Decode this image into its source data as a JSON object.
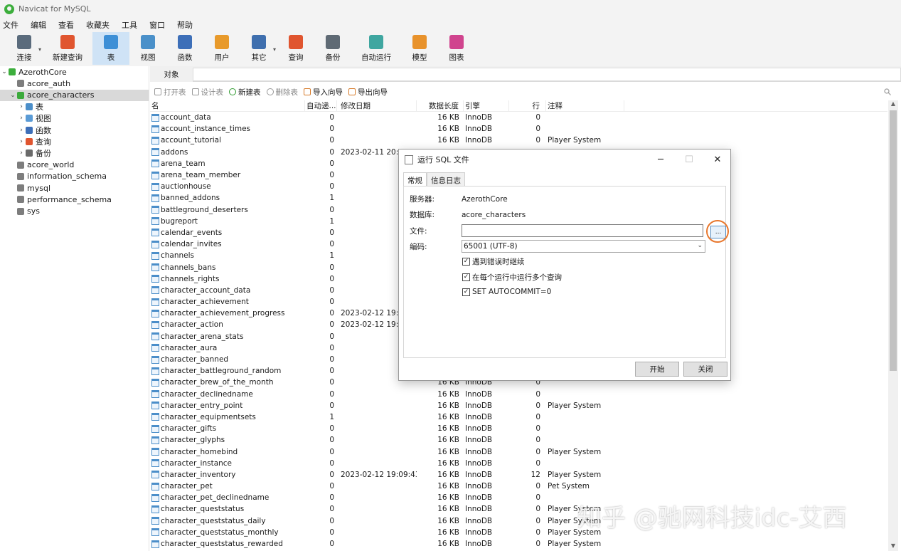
{
  "window": {
    "title": "Navicat for MySQL"
  },
  "menu": [
    "文件",
    "编辑",
    "查看",
    "收藏夹",
    "工具",
    "窗口",
    "帮助"
  ],
  "toolbar": [
    {
      "label": "连接",
      "icon": "connection-icon",
      "color": "#5a6b7c",
      "caret": true
    },
    {
      "label": "新建查询",
      "icon": "new-query-icon",
      "color": "#e0552f"
    },
    {
      "label": "表",
      "icon": "table-icon",
      "color": "#3d8fd6",
      "active": true
    },
    {
      "label": "视图",
      "icon": "view-icon",
      "color": "#4a90c9"
    },
    {
      "label": "函数",
      "icon": "function-icon",
      "color": "#3d6fb8"
    },
    {
      "label": "用户",
      "icon": "user-icon",
      "color": "#e89a2b"
    },
    {
      "label": "其它",
      "icon": "tools-icon",
      "color": "#3f6fae",
      "caret": true
    },
    {
      "label": "查询",
      "icon": "query-icon",
      "color": "#e0552f"
    },
    {
      "label": "备份",
      "icon": "backup-icon",
      "color": "#5f6a74"
    },
    {
      "label": "自动运行",
      "icon": "robot-icon",
      "color": "#3fa6a0"
    },
    {
      "label": "模型",
      "icon": "model-icon",
      "color": "#e8922b"
    },
    {
      "label": "图表",
      "icon": "chart-icon",
      "color": "#d0448e"
    }
  ],
  "sidebar": {
    "items": [
      {
        "label": "AzerothCore",
        "type": "connection",
        "arrow": "v",
        "indent": 0
      },
      {
        "label": "acore_auth",
        "type": "db",
        "arrow": "",
        "indent": 1
      },
      {
        "label": "acore_characters",
        "type": "db-open",
        "arrow": "v",
        "indent": 1,
        "selected": true
      },
      {
        "label": "表",
        "type": "table",
        "arrow": ">",
        "indent": 2
      },
      {
        "label": "视图",
        "type": "view",
        "arrow": ">",
        "indent": 2
      },
      {
        "label": "函数",
        "type": "func",
        "arrow": ">",
        "indent": 2
      },
      {
        "label": "查询",
        "type": "query",
        "arrow": ">",
        "indent": 2
      },
      {
        "label": "备份",
        "type": "backup",
        "arrow": ">",
        "indent": 2
      },
      {
        "label": "acore_world",
        "type": "db",
        "arrow": "",
        "indent": 1
      },
      {
        "label": "information_schema",
        "type": "db",
        "arrow": "",
        "indent": 1
      },
      {
        "label": "mysql",
        "type": "db",
        "arrow": "",
        "indent": 1
      },
      {
        "label": "performance_schema",
        "type": "db",
        "arrow": "",
        "indent": 1
      },
      {
        "label": "sys",
        "type": "db",
        "arrow": "",
        "indent": 1
      }
    ]
  },
  "tabs": {
    "objects": "对象"
  },
  "object_toolbar": {
    "open_table": "打开表",
    "design_table": "设计表",
    "new_table": "新建表",
    "delete_table": "删除表",
    "import_wizard": "导入向导",
    "export_wizard": "导出向导"
  },
  "grid": {
    "headers": {
      "name": "名",
      "auto_inc": "自动递...",
      "modified": "修改日期",
      "size": "数据长度",
      "engine": "引擎",
      "rows": "行",
      "comment": "注释"
    },
    "rows": [
      {
        "name": "account_data",
        "auto": "0",
        "date": "",
        "size": "16 KB",
        "engine": "InnoDB",
        "rows": "0",
        "comment": ""
      },
      {
        "name": "account_instance_times",
        "auto": "0",
        "date": "",
        "size": "16 KB",
        "engine": "InnoDB",
        "rows": "0",
        "comment": ""
      },
      {
        "name": "account_tutorial",
        "auto": "0",
        "date": "",
        "size": "16 KB",
        "engine": "InnoDB",
        "rows": "0",
        "comment": "Player System"
      },
      {
        "name": "addons",
        "auto": "0",
        "date": "2023-02-11 20:2",
        "size": "",
        "engine": "",
        "rows": "",
        "comment": ""
      },
      {
        "name": "arena_team",
        "auto": "0",
        "date": "",
        "size": "",
        "engine": "",
        "rows": "",
        "comment": ""
      },
      {
        "name": "arena_team_member",
        "auto": "0",
        "date": "",
        "size": "",
        "engine": "",
        "rows": "",
        "comment": ""
      },
      {
        "name": "auctionhouse",
        "auto": "0",
        "date": "",
        "size": "",
        "engine": "",
        "rows": "",
        "comment": ""
      },
      {
        "name": "banned_addons",
        "auto": "1",
        "date": "",
        "size": "",
        "engine": "",
        "rows": "",
        "comment": ""
      },
      {
        "name": "battleground_deserters",
        "auto": "0",
        "date": "",
        "size": "",
        "engine": "",
        "rows": "",
        "comment": ""
      },
      {
        "name": "bugreport",
        "auto": "1",
        "date": "",
        "size": "",
        "engine": "",
        "rows": "",
        "comment": ""
      },
      {
        "name": "calendar_events",
        "auto": "0",
        "date": "",
        "size": "",
        "engine": "",
        "rows": "",
        "comment": ""
      },
      {
        "name": "calendar_invites",
        "auto": "0",
        "date": "",
        "size": "",
        "engine": "",
        "rows": "",
        "comment": ""
      },
      {
        "name": "channels",
        "auto": "1",
        "date": "",
        "size": "",
        "engine": "",
        "rows": "",
        "comment": ""
      },
      {
        "name": "channels_bans",
        "auto": "0",
        "date": "",
        "size": "",
        "engine": "",
        "rows": "",
        "comment": ""
      },
      {
        "name": "channels_rights",
        "auto": "0",
        "date": "",
        "size": "",
        "engine": "",
        "rows": "",
        "comment": ""
      },
      {
        "name": "character_account_data",
        "auto": "0",
        "date": "",
        "size": "",
        "engine": "",
        "rows": "",
        "comment": ""
      },
      {
        "name": "character_achievement",
        "auto": "0",
        "date": "",
        "size": "",
        "engine": "",
        "rows": "",
        "comment": ""
      },
      {
        "name": "character_achievement_progress",
        "auto": "0",
        "date": "2023-02-12 19:0",
        "size": "",
        "engine": "",
        "rows": "",
        "comment": ""
      },
      {
        "name": "character_action",
        "auto": "0",
        "date": "2023-02-12 19:0",
        "size": "",
        "engine": "",
        "rows": "",
        "comment": ""
      },
      {
        "name": "character_arena_stats",
        "auto": "0",
        "date": "",
        "size": "",
        "engine": "",
        "rows": "",
        "comment": ""
      },
      {
        "name": "character_aura",
        "auto": "0",
        "date": "",
        "size": "",
        "engine": "",
        "rows": "",
        "comment": ""
      },
      {
        "name": "character_banned",
        "auto": "0",
        "date": "",
        "size": "",
        "engine": "",
        "rows": "",
        "comment": ""
      },
      {
        "name": "character_battleground_random",
        "auto": "0",
        "date": "",
        "size": "",
        "engine": "",
        "rows": "",
        "comment": ""
      },
      {
        "name": "character_brew_of_the_month",
        "auto": "0",
        "date": "",
        "size": "16 KB",
        "engine": "InnoDB",
        "rows": "0",
        "comment": ""
      },
      {
        "name": "character_declinedname",
        "auto": "0",
        "date": "",
        "size": "16 KB",
        "engine": "InnoDB",
        "rows": "0",
        "comment": ""
      },
      {
        "name": "character_entry_point",
        "auto": "0",
        "date": "",
        "size": "16 KB",
        "engine": "InnoDB",
        "rows": "0",
        "comment": "Player System"
      },
      {
        "name": "character_equipmentsets",
        "auto": "1",
        "date": "",
        "size": "16 KB",
        "engine": "InnoDB",
        "rows": "0",
        "comment": ""
      },
      {
        "name": "character_gifts",
        "auto": "0",
        "date": "",
        "size": "16 KB",
        "engine": "InnoDB",
        "rows": "0",
        "comment": ""
      },
      {
        "name": "character_glyphs",
        "auto": "0",
        "date": "",
        "size": "16 KB",
        "engine": "InnoDB",
        "rows": "0",
        "comment": ""
      },
      {
        "name": "character_homebind",
        "auto": "0",
        "date": "",
        "size": "16 KB",
        "engine": "InnoDB",
        "rows": "0",
        "comment": "Player System"
      },
      {
        "name": "character_instance",
        "auto": "0",
        "date": "",
        "size": "16 KB",
        "engine": "InnoDB",
        "rows": "0",
        "comment": ""
      },
      {
        "name": "character_inventory",
        "auto": "0",
        "date": "2023-02-12 19:09:43",
        "size": "16 KB",
        "engine": "InnoDB",
        "rows": "12",
        "comment": "Player System"
      },
      {
        "name": "character_pet",
        "auto": "0",
        "date": "",
        "size": "16 KB",
        "engine": "InnoDB",
        "rows": "0",
        "comment": "Pet System"
      },
      {
        "name": "character_pet_declinedname",
        "auto": "0",
        "date": "",
        "size": "16 KB",
        "engine": "InnoDB",
        "rows": "0",
        "comment": ""
      },
      {
        "name": "character_queststatus",
        "auto": "0",
        "date": "",
        "size": "16 KB",
        "engine": "InnoDB",
        "rows": "0",
        "comment": "Player System"
      },
      {
        "name": "character_queststatus_daily",
        "auto": "0",
        "date": "",
        "size": "16 KB",
        "engine": "InnoDB",
        "rows": "0",
        "comment": "Player System"
      },
      {
        "name": "character_queststatus_monthly",
        "auto": "0",
        "date": "",
        "size": "16 KB",
        "engine": "InnoDB",
        "rows": "0",
        "comment": "Player System"
      },
      {
        "name": "character_queststatus_rewarded",
        "auto": "0",
        "date": "",
        "size": "16 KB",
        "engine": "InnoDB",
        "rows": "0",
        "comment": "Player System"
      }
    ]
  },
  "dialog": {
    "title": "运行 SQL 文件",
    "tabs": {
      "general": "常规",
      "log": "信息日志"
    },
    "server_label": "服务器:",
    "server_value": "AzerothCore",
    "database_label": "数据库:",
    "database_value": "acore_characters",
    "file_label": "文件:",
    "file_value": "",
    "encoding_label": "编码:",
    "encoding_value": "65001 (UTF-8)",
    "browse_label": "...",
    "options": [
      {
        "label": "遇到错误时继续",
        "checked": true
      },
      {
        "label": "在每个运行中运行多个查询",
        "checked": true
      },
      {
        "label": "SET AUTOCOMMIT=0",
        "checked": true
      }
    ],
    "start_button": "开始",
    "close_button": "关闭",
    "highlight_color": "#e8772d"
  },
  "watermark": "知乎 @驰网科技idc-艾西"
}
